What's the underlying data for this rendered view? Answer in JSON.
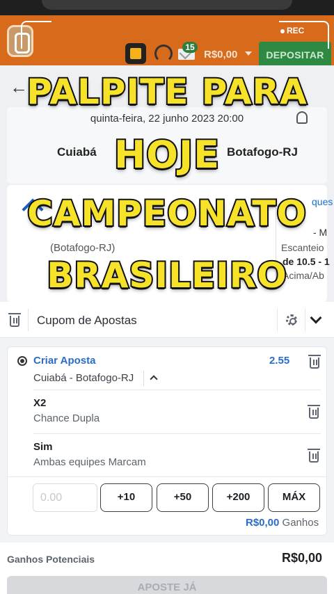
{
  "header": {
    "balance": "R$0,00",
    "deposit_label": "DEPOSITAR",
    "mail_badge": "15",
    "recording_label": "REC",
    "colors": {
      "bar": "#d86a1c",
      "deposit": "#2e8a43"
    },
    "icons": [
      "brand-logo-icon",
      "gift-icon",
      "headset-icon",
      "mail-icon",
      "chevron-down-icon"
    ]
  },
  "overlay": {
    "lines": [
      "PALPITE PARA",
      "HOJE",
      "CAMPEONATO",
      "BRASILEIRO"
    ],
    "color": "#f7e22a"
  },
  "match": {
    "date": "quinta-feira, 22 junho 2023 20:00",
    "home": "Cuiabá",
    "away": "Botafogo-RJ",
    "left_detail": "(Botafogo-RJ)",
    "right_lines": [
      "ques",
      "- M",
      "Escanteio",
      "de 10.5 - 1",
      "Acima/Ab"
    ]
  },
  "coupon": {
    "title": "Cupom de Apostas",
    "bet": {
      "title": "Criar Aposta",
      "odds": "2.55",
      "event": "Cuiabá - Botafogo-RJ",
      "selections": [
        {
          "pick": "X2",
          "market": "Chance Dupla"
        },
        {
          "pick": "Sim",
          "market": "Ambas equipes Marcam"
        }
      ]
    },
    "stake_placeholder": "0.00",
    "quick_amounts": [
      "+10",
      "+50",
      "+200",
      "MÁX"
    ],
    "winnings_amount": "R$0,00",
    "winnings_label": "Ganhos",
    "potential_label": "Ganhos Potenciais",
    "potential_value": "R$0,00",
    "place_bet_label": "APOSTE JÁ",
    "accent_color": "#2a6cc7"
  }
}
